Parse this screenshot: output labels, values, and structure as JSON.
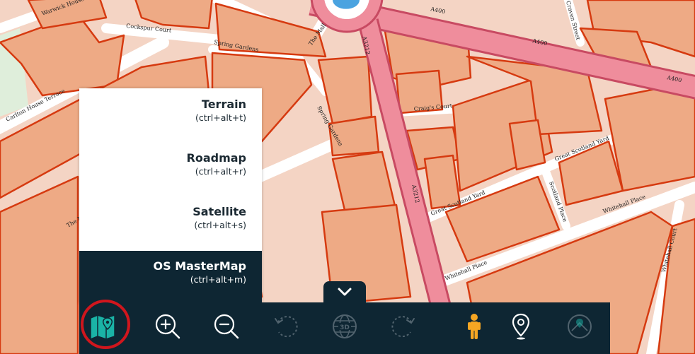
{
  "map": {
    "style": "OS MasterMap",
    "colors": {
      "building_fill": "#eeaa85",
      "building_outline": "#d63a10",
      "land": "#f4d4c4",
      "road": "#ffffff",
      "a_road": "#ef8d9c",
      "a_road_edge": "#c84a62",
      "water": "#4aa3e0",
      "park": "#dfeedb"
    },
    "labels": {
      "warwick_house": "Warwick House",
      "cockspur_court": "Cockspur Court",
      "spring_gardens": "Spring Gardens",
      "the_mall_1": "The Mall",
      "the_mall_2": "The Mall",
      "carlton_house_terrace": "Carlton House Terrace",
      "a400_1": "A400",
      "a400_2": "A400",
      "a400_3": "A400",
      "a3212_1": "A3212",
      "a3212_2": "A3212",
      "admiralty_court": "Craig's Court",
      "great_scotland_yard_1": "Great Scotland Yard",
      "great_scotland_yard_2": "Great Scotland Yard",
      "scotland_place": "Scotland Place",
      "whitehall_place_1": "Whitehall Place",
      "whitehall_place_2": "Whitehall Place",
      "whitehall_court": "Whitehall Court",
      "craven_street": "Craven Street",
      "spring_gardens_2": "Spring Gardens"
    }
  },
  "map_type_menu": {
    "items": [
      {
        "label": "Terrain",
        "shortcut": "(ctrl+alt+t)",
        "selected": false
      },
      {
        "label": "Roadmap",
        "shortcut": "(ctrl+alt+r)",
        "selected": false
      },
      {
        "label": "Satellite",
        "shortcut": "(ctrl+alt+s)",
        "selected": false
      },
      {
        "label": "OS MasterMap",
        "shortcut": "(ctrl+alt+m)",
        "selected": true
      }
    ]
  },
  "toolbar": {
    "background": "#0e2633",
    "accent": "#1ab3a6",
    "highlight": "#d0161d",
    "buttons": [
      {
        "name": "map-type",
        "icon": "map-pin-icon",
        "enabled": true,
        "active": true
      },
      {
        "name": "zoom-in",
        "icon": "zoom-in-icon",
        "enabled": true
      },
      {
        "name": "zoom-out",
        "icon": "zoom-out-icon",
        "enabled": true
      },
      {
        "name": "rotate-left",
        "icon": "rotate-left-icon",
        "enabled": false
      },
      {
        "name": "3d-view",
        "icon": "globe-3d-icon",
        "enabled": false,
        "label": "3D"
      },
      {
        "name": "rotate-right",
        "icon": "rotate-right-icon",
        "enabled": false
      },
      {
        "name": "street-view",
        "icon": "pegman-icon",
        "enabled": true
      },
      {
        "name": "location",
        "icon": "location-pin-icon",
        "enabled": true
      },
      {
        "name": "map-layers",
        "icon": "map-layers-icon",
        "enabled": false
      }
    ],
    "collapse_icon": "chevron-down-icon"
  }
}
